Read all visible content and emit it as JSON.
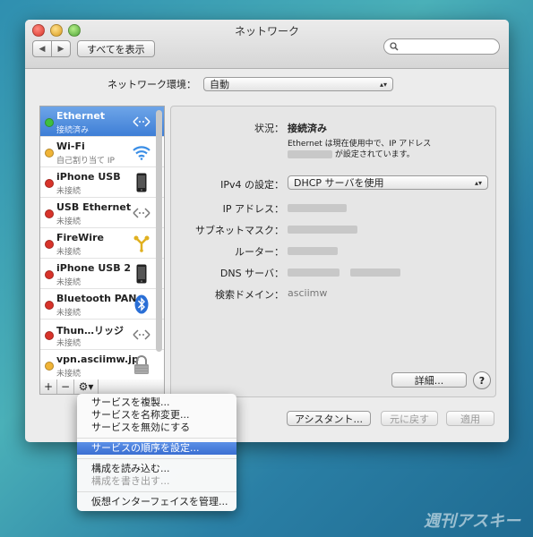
{
  "window": {
    "title": "ネットワーク",
    "show_all": "すべてを表示",
    "search_placeholder": ""
  },
  "location": {
    "label": "ネットワーク環境：",
    "value": "自動"
  },
  "services": [
    {
      "name": "Ethernet",
      "status": "接続済み",
      "dot": "green",
      "icon": "ethernet-icon",
      "selected": true
    },
    {
      "name": "Wi-Fi",
      "status": "自己割り当て IP",
      "dot": "yellow",
      "icon": "wifi-icon"
    },
    {
      "name": "iPhone USB",
      "status": "未接続",
      "dot": "red",
      "icon": "iphone-icon"
    },
    {
      "name": "USB Ethernet",
      "status": "未接続",
      "dot": "red",
      "icon": "ethernet-icon"
    },
    {
      "name": "FireWire",
      "status": "未接続",
      "dot": "red",
      "icon": "firewire-icon"
    },
    {
      "name": "iPhone USB 2",
      "status": "未接続",
      "dot": "red",
      "icon": "iphone-icon"
    },
    {
      "name": "Bluetooth PAN",
      "status": "未接続",
      "dot": "red",
      "icon": "bluetooth-icon"
    },
    {
      "name": "Thun…リッジ",
      "status": "未接続",
      "dot": "red",
      "icon": "ethernet-icon"
    },
    {
      "name": "vpn.asciimw.jp",
      "status": "未接続",
      "dot": "yellow",
      "icon": "lock-icon"
    }
  ],
  "detail": {
    "status_label": "状況：",
    "status_value": "接続済み",
    "status_desc1": "Ethernet は現在使用中で、IP アドレス",
    "status_desc2": "が設定されています。",
    "ipv4_label": "IPv4 の設定：",
    "ipv4_value": "DHCP サーバを使用",
    "ip_label": "IP アドレス：",
    "subnet_label": "サブネットマスク：",
    "router_label": "ルーター：",
    "dns_label": "DNS サーバ：",
    "search_domain_label": "検索ドメイン：",
    "search_domain_value": "asciimw",
    "advanced_button": "詳細...",
    "help": "?"
  },
  "footer": {
    "assistant": "アシスタント...",
    "revert": "元に戻す",
    "apply": "適用"
  },
  "menu": {
    "items": [
      "サービスを複製...",
      "サービスを名称変更...",
      "サービスを無効にする",
      "サービスの順序を設定...",
      "構成を読み込む...",
      "構成を書き出す...",
      "仮想インターフェイスを管理..."
    ]
  },
  "watermark": "週刊アスキー"
}
